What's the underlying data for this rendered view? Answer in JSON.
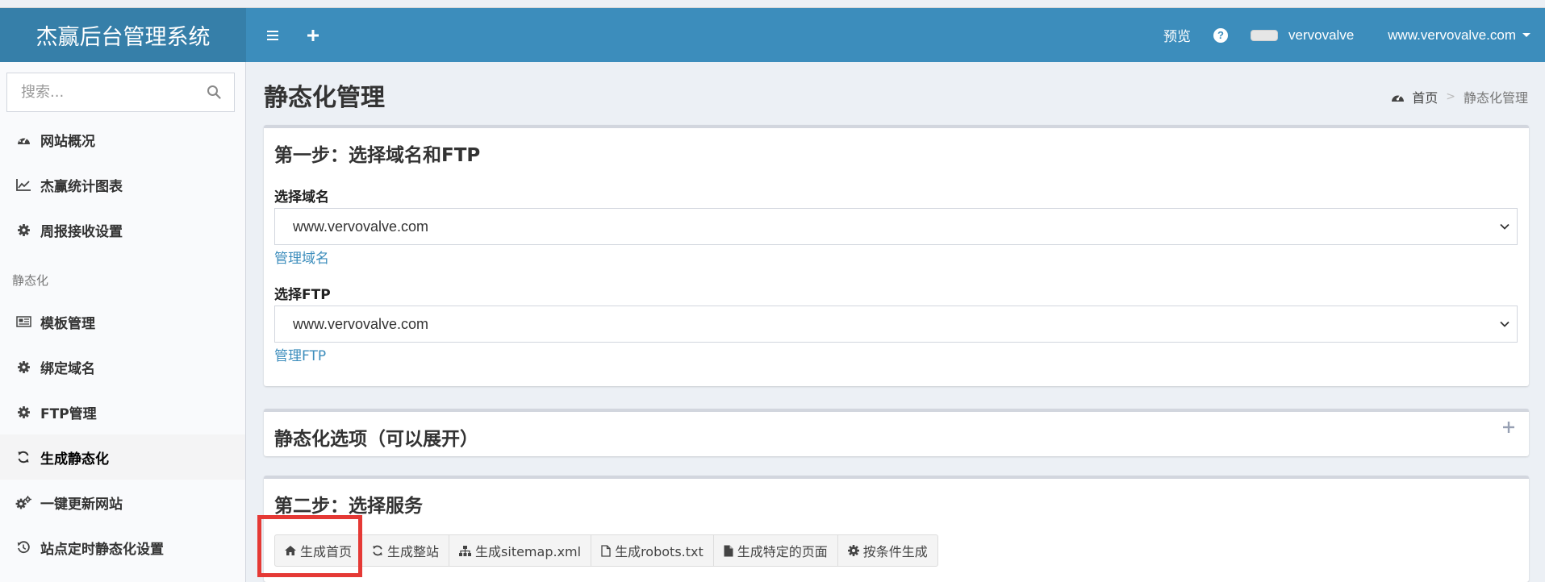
{
  "header": {
    "logo": "杰赢后台管理系统",
    "preview": "预览",
    "username": "vervovalve",
    "site": "www.vervovalve.com"
  },
  "sidebar": {
    "search_placeholder": "搜索...",
    "items": [
      {
        "label": "网站概况",
        "icon": "dashboard-icon"
      },
      {
        "label": "杰赢统计图表",
        "icon": "line-chart-icon"
      },
      {
        "label": "周报接收设置",
        "icon": "gear-icon"
      }
    ],
    "section_header": "静态化",
    "section_items": [
      {
        "label": "模板管理",
        "icon": "newspaper-icon"
      },
      {
        "label": "绑定域名",
        "icon": "gear-icon"
      },
      {
        "label": "FTP管理",
        "icon": "gear-icon"
      },
      {
        "label": "生成静态化",
        "icon": "refresh-icon",
        "active": true
      },
      {
        "label": "一键更新网站",
        "icon": "gears-icon"
      },
      {
        "label": "站点定时静态化设置",
        "icon": "history-icon"
      }
    ]
  },
  "content": {
    "page_title": "静态化管理",
    "breadcrumb": {
      "home": "首页",
      "current": "静态化管理"
    },
    "step1": {
      "title": "第一步：选择域名和FTP",
      "domain_label": "选择域名",
      "domain_value": "www.vervovalve.com",
      "domain_link": "管理域名",
      "ftp_label": "选择FTP",
      "ftp_value": "www.vervovalve.com",
      "ftp_link": "管理FTP"
    },
    "options": {
      "title": "静态化选项（可以展开）"
    },
    "step2": {
      "title": "第二步：选择服务",
      "buttons": [
        {
          "label": "生成首页",
          "icon": "home-icon"
        },
        {
          "label": "生成整站",
          "icon": "refresh-icon"
        },
        {
          "label": "生成sitemap.xml",
          "icon": "sitemap-icon"
        },
        {
          "label": "生成robots.txt",
          "icon": "file-outline-icon"
        },
        {
          "label": "生成特定的页面",
          "icon": "file-icon"
        },
        {
          "label": "按条件生成",
          "icon": "gear-icon"
        }
      ]
    }
  },
  "colors": {
    "header_bg": "#3c8dbc",
    "logo_bg": "#367fa9",
    "link": "#3c8dbc",
    "highlight": "#e53935"
  }
}
